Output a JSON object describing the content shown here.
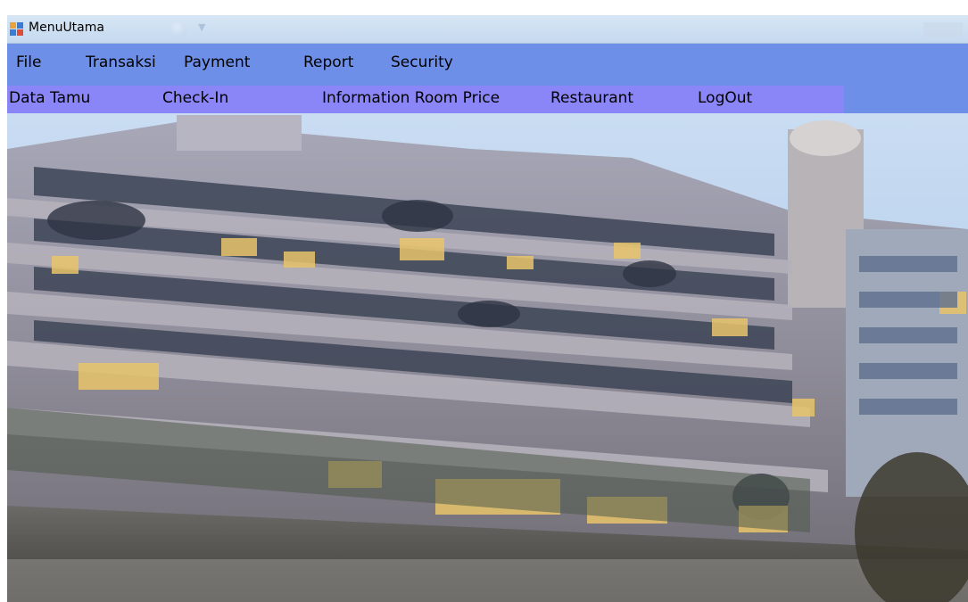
{
  "window": {
    "title": "MenuUtama"
  },
  "menubar": {
    "items": [
      {
        "label": "File"
      },
      {
        "label": "Transaksi"
      },
      {
        "label": "Payment"
      },
      {
        "label": "Report"
      },
      {
        "label": "Security"
      }
    ]
  },
  "toolstrip": {
    "buttons": [
      {
        "label": "Data Tamu"
      },
      {
        "label": "Check-In"
      },
      {
        "label": "Information Room Price"
      },
      {
        "label": "Restaurant"
      },
      {
        "label": "LogOut"
      }
    ]
  },
  "colors": {
    "menubar_bg": "#6e8fe7",
    "toolstrip_bg": "#8a86f7",
    "titlebar_bg": "#d7e6f5"
  },
  "background": {
    "icon": "hotel-building-photo"
  }
}
